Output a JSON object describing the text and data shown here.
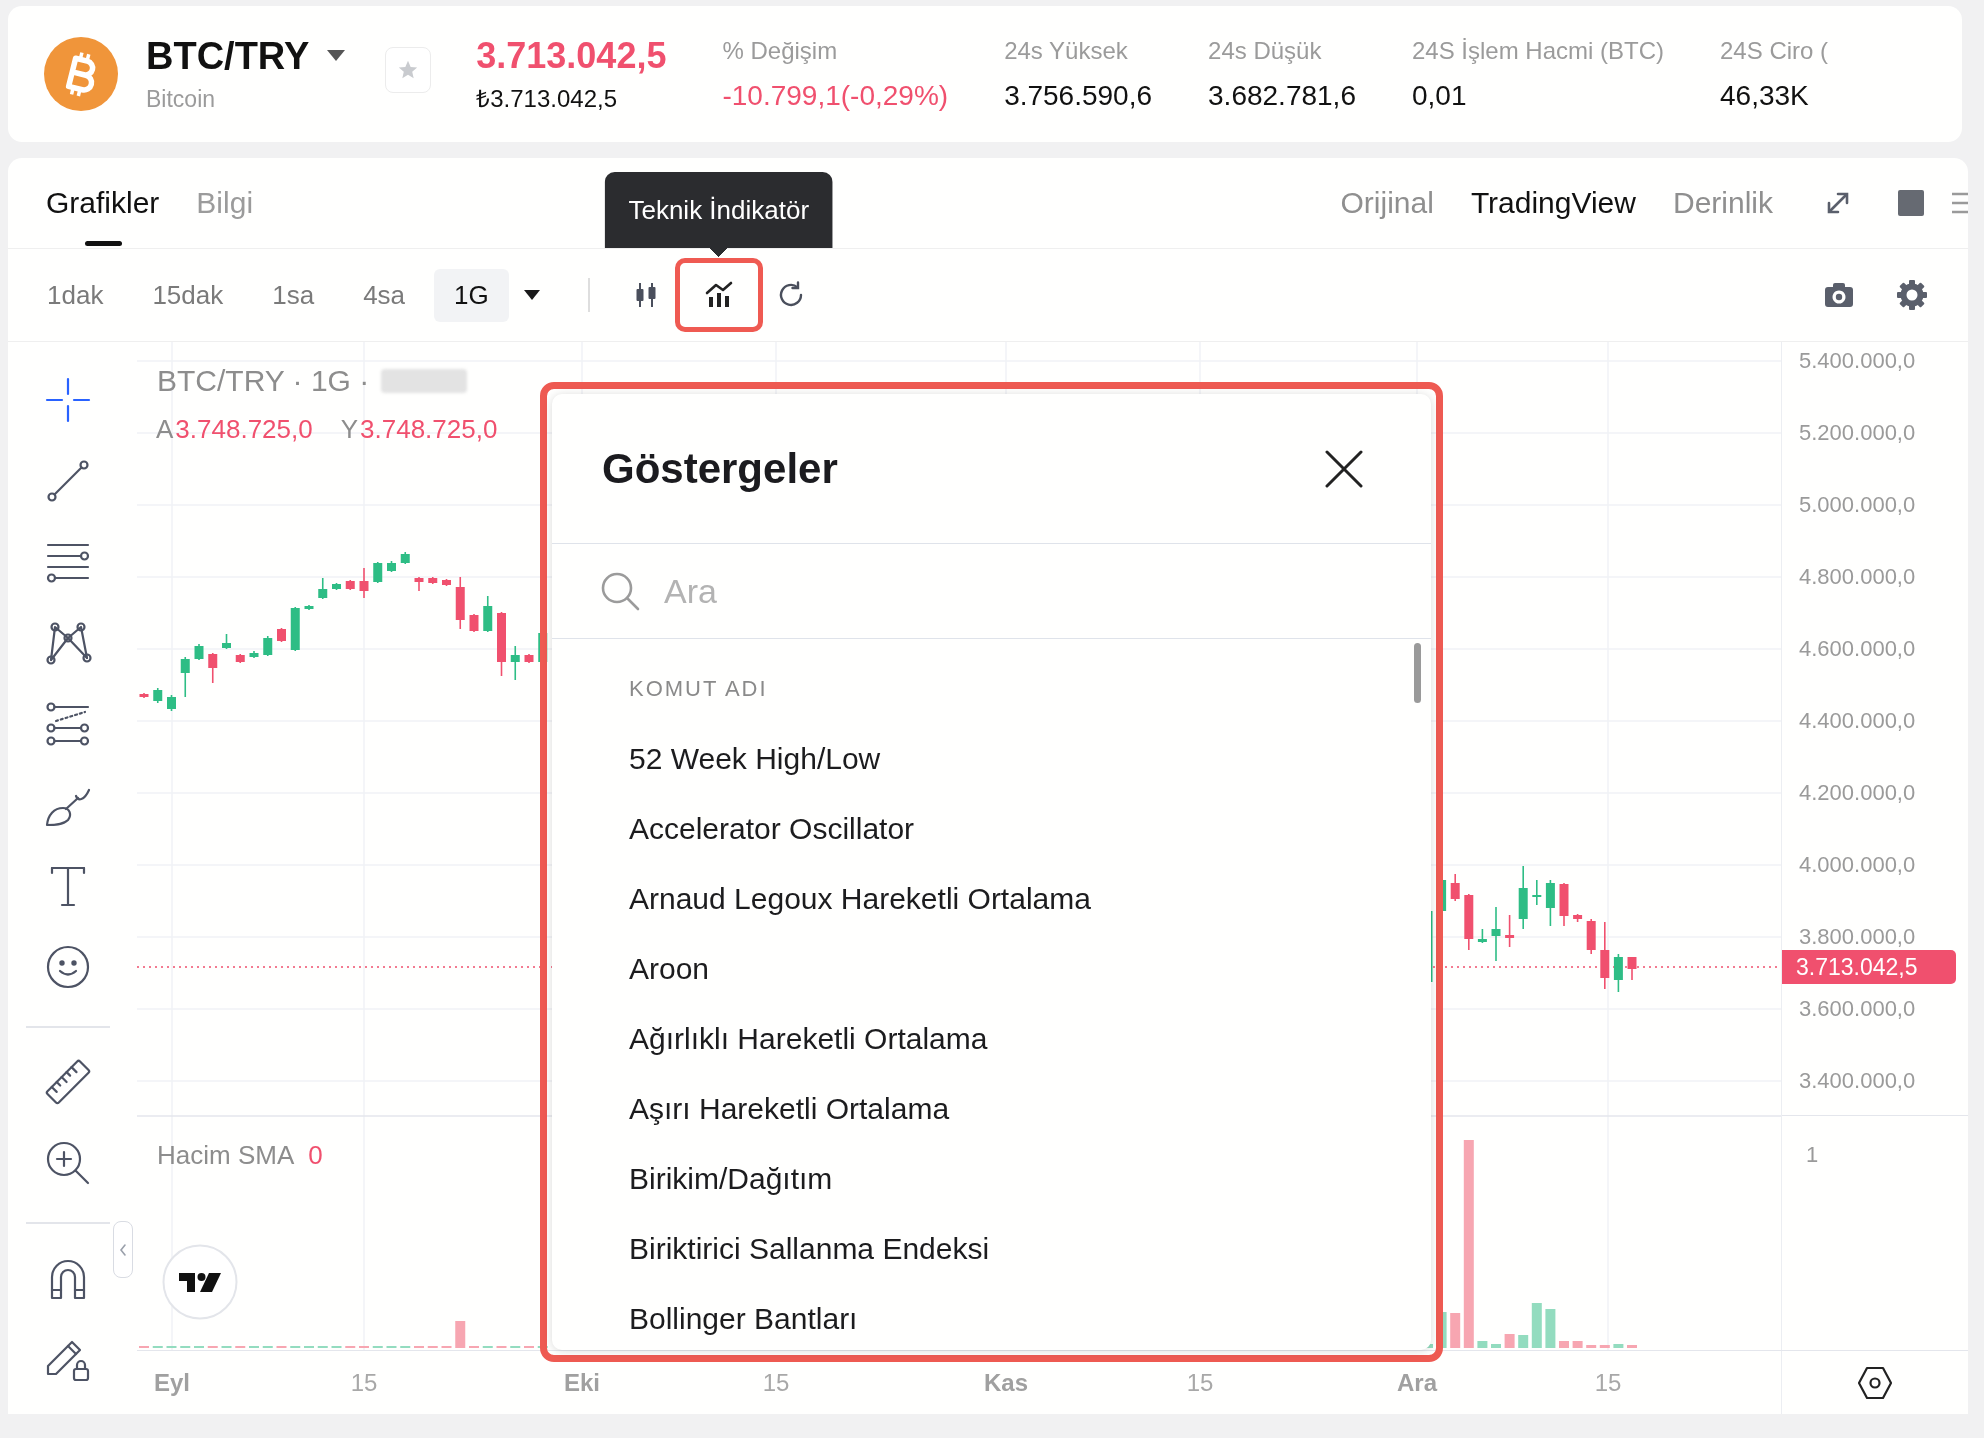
{
  "ticker": {
    "symbol": "BTC/TRY",
    "name": "Bitcoin",
    "favorite": false,
    "price": "3.713.042,5",
    "falling": true,
    "price_local": "₺3.713.042,5",
    "stats": [
      {
        "label": "% Değişim",
        "value": "-10.799,1(-0,29%)",
        "falling": true
      },
      {
        "label": "24s Yüksek",
        "value": "3.756.590,6",
        "falling": false
      },
      {
        "label": "24s Düşük",
        "value": "3.682.781,6",
        "falling": false
      },
      {
        "label": "24S İşlem Hacmi (BTC)",
        "value": "0,01",
        "falling": false
      },
      {
        "label": "24S Ciro (",
        "value": "46,33K",
        "falling": false
      }
    ]
  },
  "tabs": [
    {
      "label": "Grafikler",
      "selected": true
    },
    {
      "label": "Bilgi",
      "selected": false
    }
  ],
  "views": [
    {
      "label": "Orijinal",
      "selected": false
    },
    {
      "label": "TradingView",
      "selected": true
    },
    {
      "label": "Derinlik",
      "selected": false
    }
  ],
  "toolbar": {
    "intervals": [
      {
        "label": "1dak",
        "selected": false
      },
      {
        "label": "15dak",
        "selected": false
      },
      {
        "label": "1sa",
        "selected": false
      },
      {
        "label": "4sa",
        "selected": false
      },
      {
        "label": "1G",
        "selected": true
      }
    ],
    "indicator_button": {
      "highlighted": true
    },
    "tooltip": "Teknik İndikatör"
  },
  "drawing_tools": [
    {
      "tools": [
        {
          "kind": "crosshair",
          "selected": true
        },
        {
          "kind": "trend_line",
          "selected": false
        },
        {
          "kind": "horizontal_lines",
          "selected": false
        },
        {
          "kind": "pattern",
          "selected": false
        },
        {
          "kind": "parallel_channel",
          "selected": false
        },
        {
          "kind": "brush",
          "selected": false
        },
        {
          "kind": "text",
          "selected": false
        },
        {
          "kind": "emoji",
          "selected": false
        }
      ]
    },
    {
      "tools": [
        {
          "kind": "ruler",
          "selected": false
        },
        {
          "kind": "zoom",
          "selected": false
        }
      ]
    },
    {
      "tools": [
        {
          "kind": "magnet",
          "selected": false
        },
        {
          "kind": "lock_drawing",
          "selected": false
        }
      ]
    }
  ],
  "chart": {
    "title": "BTC/TRY · 1G ·",
    "ohlc": [
      {
        "label": "A",
        "value": "3.748.725,0"
      },
      {
        "label": "Y",
        "value": "3.748.725,0"
      }
    ],
    "volume_legend": {
      "label": "Hacim SMA",
      "value": "0"
    },
    "price_axis": [
      "5.400.000,0",
      "5.200.000,0",
      "5.000.000,0",
      "4.800.000,0",
      "4.600.000,0",
      "4.400.000,0",
      "4.200.000,0",
      "4.000.000,0",
      "3.800.000,0",
      "3.600.000,0",
      "3.400.000,0"
    ],
    "current_price": "3.713.042,5",
    "volume_axis": [
      "1"
    ],
    "time_axis": [
      {
        "label": "Eyl",
        "kind": "month"
      },
      {
        "label": "15",
        "kind": "day"
      },
      {
        "label": "Eki",
        "kind": "month"
      },
      {
        "label": "15",
        "kind": "day"
      },
      {
        "label": "Kas",
        "kind": "month"
      },
      {
        "label": "15",
        "kind": "day"
      },
      {
        "label": "Ara",
        "kind": "month"
      },
      {
        "label": "15",
        "kind": "day"
      }
    ]
  },
  "indicators_dialog": {
    "highlighted": true,
    "title": "Göstergeler",
    "search": {
      "placeholder": "Ara"
    },
    "section_label": "KOMUT ADI",
    "items": [
      "52 Week High/Low",
      "Accelerator Oscillator",
      "Arnaud Legoux Hareketli Ortalama",
      "Aroon",
      "Ağırlıklı Hareketli Ortalama",
      "Aşırı Hareketli Ortalama",
      "Birikim/Dağıtım",
      "Biriktirici Sallanma Endeksi",
      "Bollinger Bantları"
    ]
  }
}
